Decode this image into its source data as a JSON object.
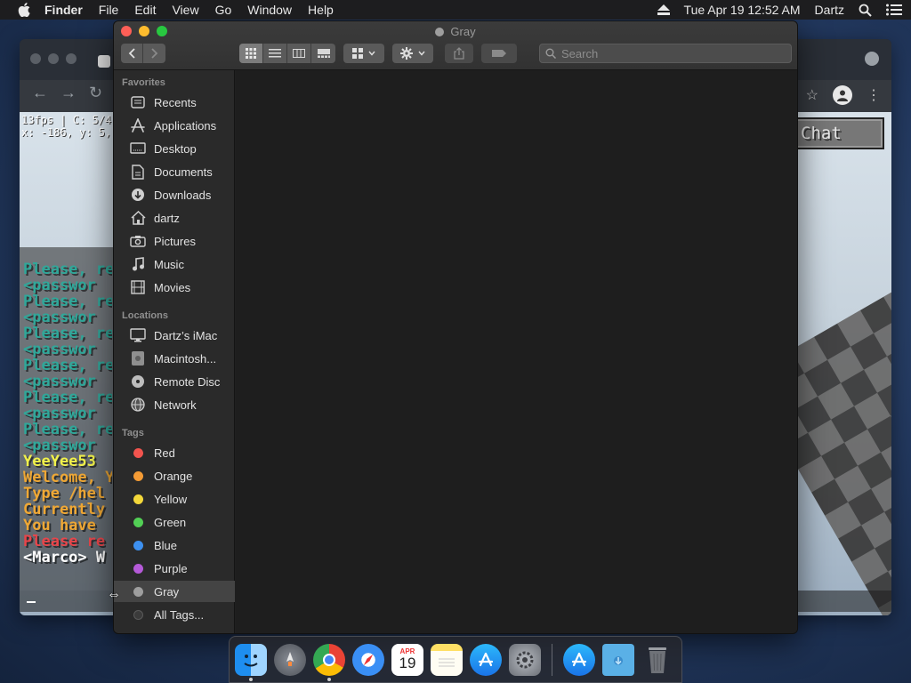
{
  "menubar": {
    "app_name": "Finder",
    "items": [
      "File",
      "Edit",
      "View",
      "Go",
      "Window",
      "Help"
    ],
    "datetime": "Tue Apr 19  12:52 AM",
    "user": "Dartz"
  },
  "background_app": {
    "hud_line1": "13fps | C: 5/4",
    "hud_line2": "x: -186, y: 5,",
    "chat_button": "Chat",
    "chat_lines": [
      {
        "text": "Please, re",
        "color": "#2fa89a"
      },
      {
        "text": " <passwor",
        "color": "#2fa89a"
      },
      {
        "text": "Please, re",
        "color": "#2fa89a"
      },
      {
        "text": " <passwor",
        "color": "#2fa89a"
      },
      {
        "text": "Please, re",
        "color": "#2fa89a"
      },
      {
        "text": " <passwor",
        "color": "#2fa89a"
      },
      {
        "text": "Please, re",
        "color": "#2fa89a"
      },
      {
        "text": " <passwor",
        "color": "#2fa89a"
      },
      {
        "text": "Please, re",
        "color": "#2fa89a"
      },
      {
        "text": " <passwor",
        "color": "#2fa89a"
      },
      {
        "text": "Please, re",
        "color": "#2fa89a"
      },
      {
        "text": " <passwor",
        "color": "#2fa89a"
      },
      {
        "text": "YeeYee53",
        "color": "#f2f24a"
      },
      {
        "text": "Welcome, Y",
        "color": "#f0a834"
      },
      {
        "text": "Type /hel",
        "color": "#f0a834"
      },
      {
        "text": "Currently",
        "color": "#f0a834"
      },
      {
        "text": "You have",
        "color": "#f0a834"
      },
      {
        "text": "Please re",
        "color": "#e8454a"
      },
      {
        "text": "<Marco> W",
        "color": "#ffffff"
      }
    ]
  },
  "finder": {
    "title": "Gray",
    "search_placeholder": "Search",
    "sections": {
      "favorites": "Favorites",
      "locations": "Locations",
      "tags": "Tags"
    },
    "favorites": [
      {
        "label": "Recents",
        "icon": "recents-icon"
      },
      {
        "label": "Applications",
        "icon": "applications-icon"
      },
      {
        "label": "Desktop",
        "icon": "desktop-icon"
      },
      {
        "label": "Documents",
        "icon": "documents-icon"
      },
      {
        "label": "Downloads",
        "icon": "downloads-icon"
      },
      {
        "label": "dartz",
        "icon": "home-icon"
      },
      {
        "label": "Pictures",
        "icon": "pictures-icon"
      },
      {
        "label": "Music",
        "icon": "music-icon"
      },
      {
        "label": "Movies",
        "icon": "movies-icon"
      }
    ],
    "locations": [
      {
        "label": "Dartz’s iMac",
        "icon": "imac-icon"
      },
      {
        "label": "Macintosh...",
        "icon": "hard-drive-icon"
      },
      {
        "label": "Remote Disc",
        "icon": "disc-icon"
      },
      {
        "label": "Network",
        "icon": "network-icon"
      }
    ],
    "tags": [
      {
        "label": "Red",
        "color": "#f2544e"
      },
      {
        "label": "Orange",
        "color": "#f49b35"
      },
      {
        "label": "Yellow",
        "color": "#f4d83a"
      },
      {
        "label": "Green",
        "color": "#52cf55"
      },
      {
        "label": "Blue",
        "color": "#3d90f0"
      },
      {
        "label": "Purple",
        "color": "#b55ad8"
      },
      {
        "label": "Gray",
        "color": "#9e9e9e"
      },
      {
        "label": "All Tags...",
        "color": "#3b3b3b"
      }
    ],
    "selected": "Gray"
  },
  "dock": {
    "calendar_month": "APR",
    "calendar_day": "19"
  }
}
